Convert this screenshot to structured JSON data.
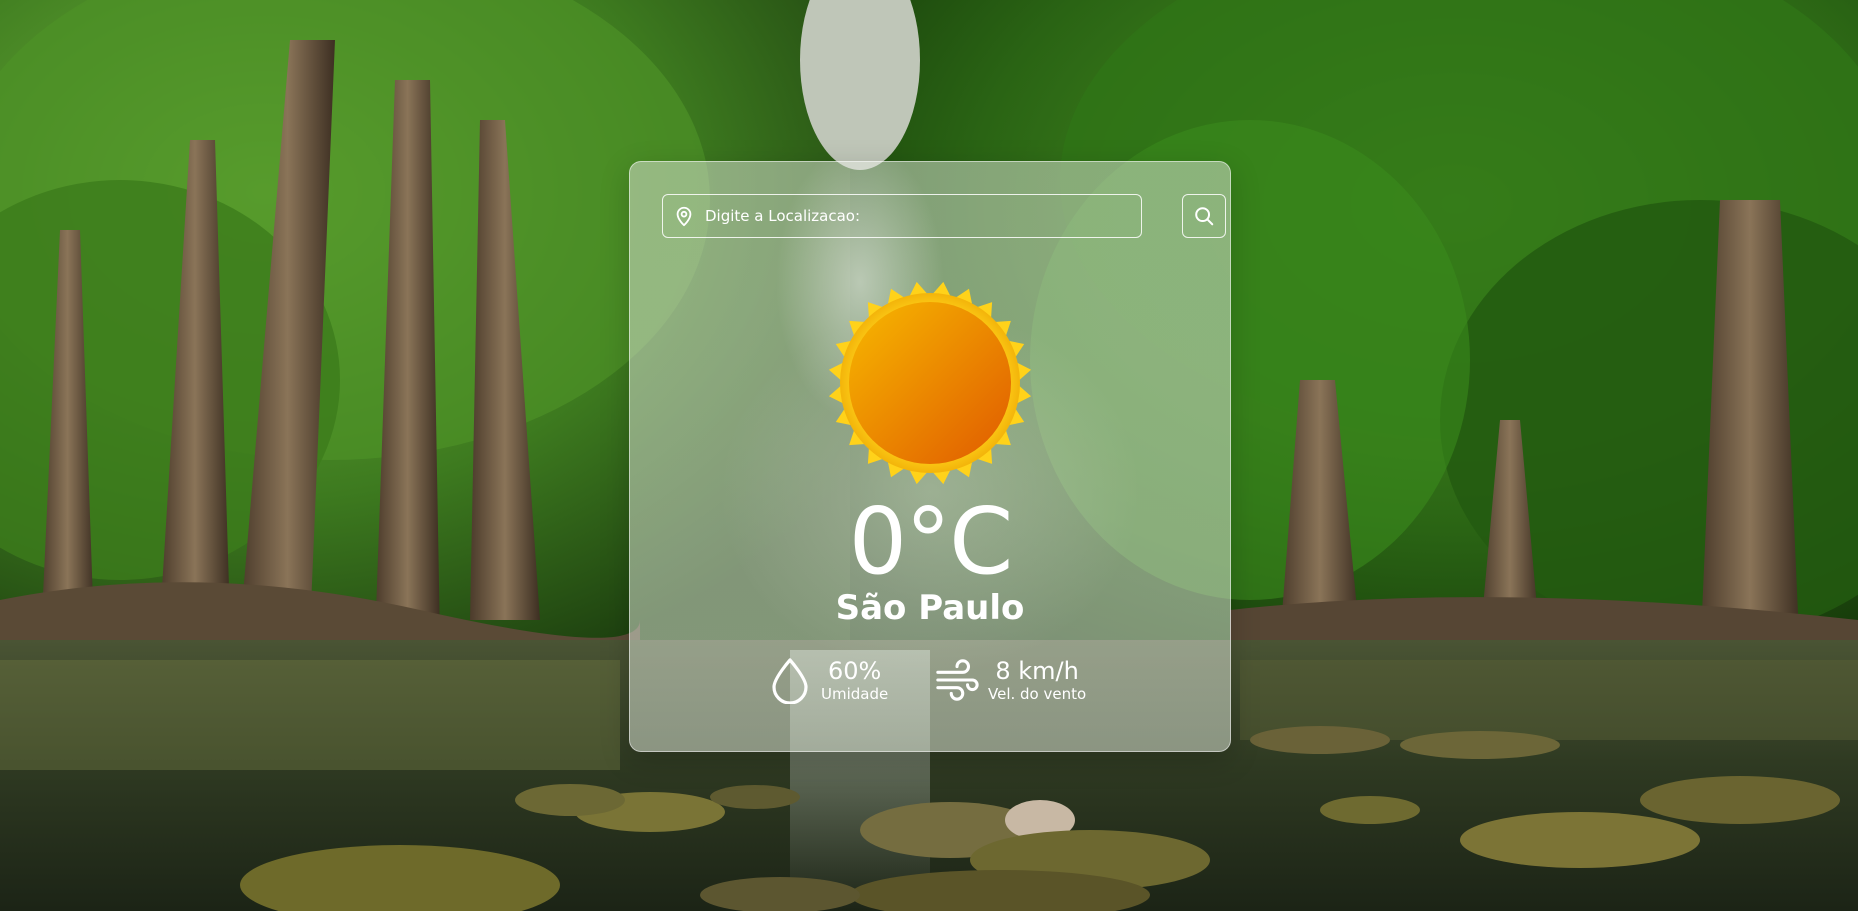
{
  "search": {
    "placeholder": "Digite a Localizacao:",
    "location_icon": "map-pin-icon",
    "button_icon": "search-icon"
  },
  "weather": {
    "icon": "sun-icon",
    "temperature": "0°C",
    "city": "São Paulo",
    "humidity": {
      "value": "60%",
      "label": "Umidade",
      "icon": "water-drop-icon"
    },
    "wind": {
      "value": "8 km/h",
      "label": "Vel. do vento",
      "icon": "wind-icon"
    }
  },
  "colors": {
    "text": "#ffffff",
    "sun_core_start": "#f7b800",
    "sun_core_end": "#e05a00",
    "sun_rays": "#ffd21a"
  }
}
